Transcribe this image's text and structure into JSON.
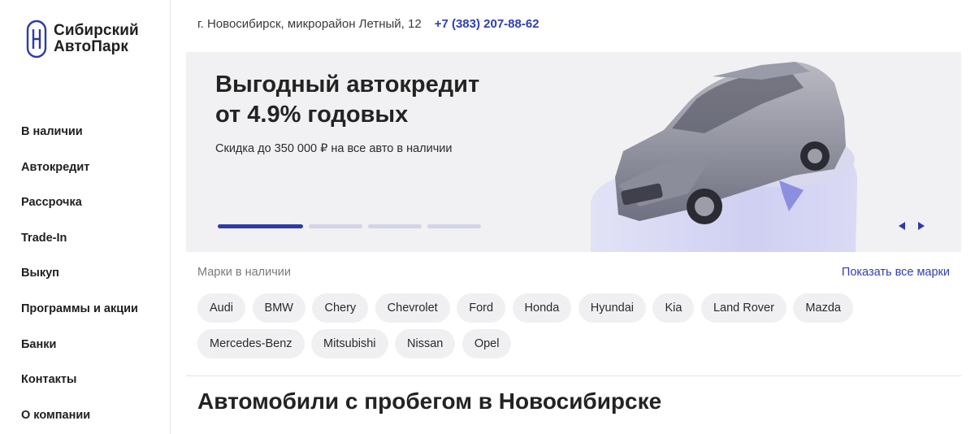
{
  "logo": {
    "line1": "Сибирский",
    "line2": "АвтоПарк"
  },
  "nav": {
    "items": [
      {
        "label": "В наличии"
      },
      {
        "label": "Автокредит"
      },
      {
        "label": "Рассрочка"
      },
      {
        "label": "Trade-In"
      },
      {
        "label": "Выкуп"
      },
      {
        "label": "Программы и акции"
      },
      {
        "label": "Банки"
      },
      {
        "label": "Контакты"
      },
      {
        "label": "О компании"
      }
    ]
  },
  "header": {
    "address": "г. Новосибирск, микрорайон Летный, 12",
    "phone": "+7 (383) 207-88-62"
  },
  "banner": {
    "title_line1": "Выгодный автокредит",
    "title_line2": "от 4.9% годовых",
    "subtitle": "Скидка до 350 000 ₽ на все авто в наличии",
    "slide_count": 4,
    "active_slide": 1
  },
  "brands": {
    "label": "Марки в наличии",
    "show_all": "Показать все марки",
    "items": [
      "Audi",
      "BMW",
      "Chery",
      "Chevrolet",
      "Ford",
      "Honda",
      "Hyundai",
      "Kia",
      "Land Rover",
      "Mazda",
      "Mercedes-Benz",
      "Mitsubishi",
      "Nissan",
      "Opel"
    ]
  },
  "section": {
    "title": "Автомобили с пробегом в Новосибирске"
  },
  "colors": {
    "accent": "#2e3aa9",
    "link": "#2f3fb0",
    "banner_bg": "#f1f1f3",
    "chip_bg": "#f0f0f2"
  }
}
